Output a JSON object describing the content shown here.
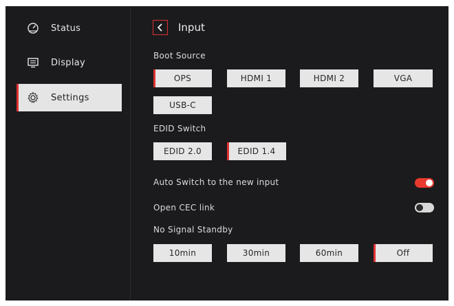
{
  "sidebar": {
    "items": [
      {
        "label": "Status",
        "icon": "gauge-icon"
      },
      {
        "label": "Display",
        "icon": "display-icon"
      },
      {
        "label": "Settings",
        "icon": "gear-icon",
        "active": true
      }
    ]
  },
  "page": {
    "title": "Input",
    "back_icon": "chevron-left-icon"
  },
  "boot_source": {
    "label": "Boot Source",
    "options": [
      "OPS",
      "HDMI 1",
      "HDMI 2",
      "VGA",
      "USB-C"
    ],
    "selected": "OPS"
  },
  "edid_switch": {
    "label": "EDID Switch",
    "options": [
      "EDID 2.0",
      "EDID 1.4"
    ],
    "selected": "EDID 1.4"
  },
  "auto_switch": {
    "label": "Auto Switch to the new input",
    "enabled": true
  },
  "cec_link": {
    "label": "Open CEC link",
    "enabled": false
  },
  "no_signal_standby": {
    "label": "No Signal Standby",
    "options": [
      "10min",
      "30min",
      "60min",
      "Off"
    ],
    "selected": "Off"
  },
  "colors": {
    "accent": "#e03030",
    "background": "#1b1b1d",
    "button": "#e6e6e6"
  }
}
